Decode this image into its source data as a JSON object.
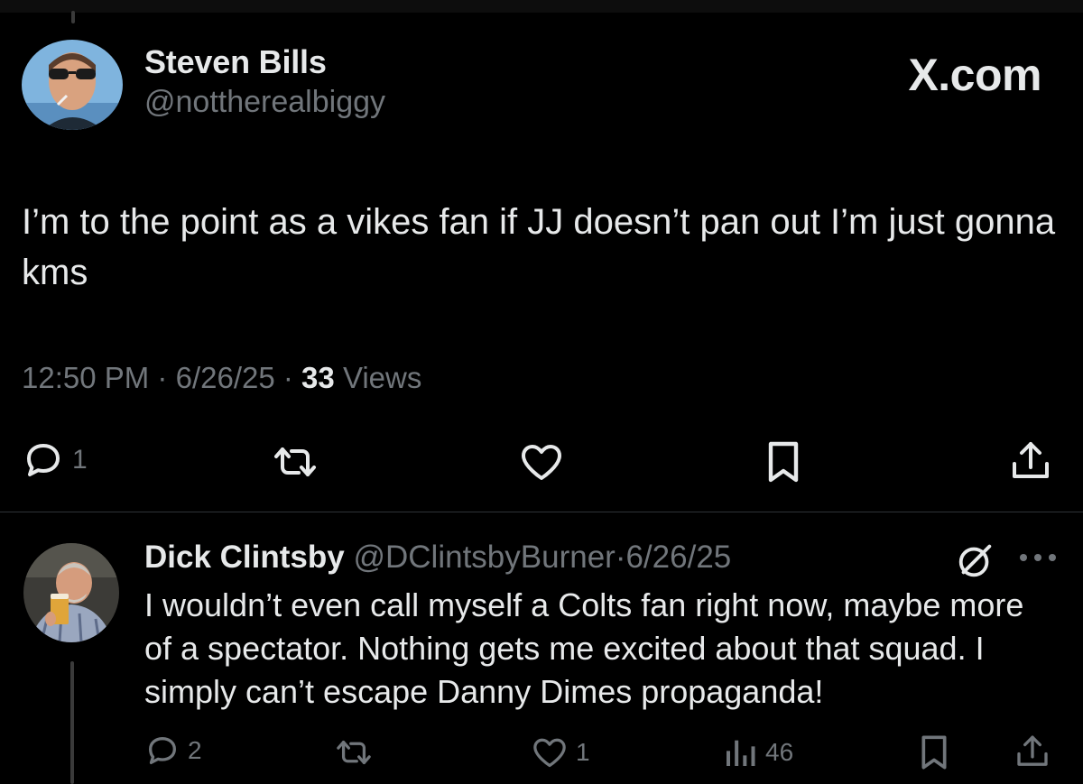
{
  "main_post": {
    "author": {
      "name": "Steven Bills",
      "handle": "@nottherealbiggy"
    },
    "brand": "X.com",
    "text": "I’m to the point as a vikes fan if JJ doesn’t pan out I’m just gonna kms",
    "meta": {
      "time": "12:50 PM",
      "dot1": "·",
      "date": "6/26/25",
      "dot2": "·",
      "views_count": "33",
      "views_label": "Views"
    },
    "actions": {
      "reply_count": "1"
    }
  },
  "reply": {
    "author": {
      "name": "Dick Clintsby",
      "handle": "@DClintsbyBurner"
    },
    "sep": "·",
    "date": "6/26/25",
    "text": "I wouldn’t even call myself a Colts fan right now, maybe more of a spectator. Nothing gets me excited about that squad. I simply can’t escape Danny Dimes propaganda!",
    "actions": {
      "reply_count": "2",
      "like_count": "1",
      "views_count": "46"
    }
  },
  "colors": {
    "background": "#000000",
    "text": "#e7e9ea",
    "muted": "#71767b",
    "divider": "#2f3336"
  },
  "icons": [
    "reply-icon",
    "repost-icon",
    "like-icon",
    "bookmark-icon",
    "share-icon",
    "views-icon",
    "grok-icon",
    "more-icon"
  ]
}
